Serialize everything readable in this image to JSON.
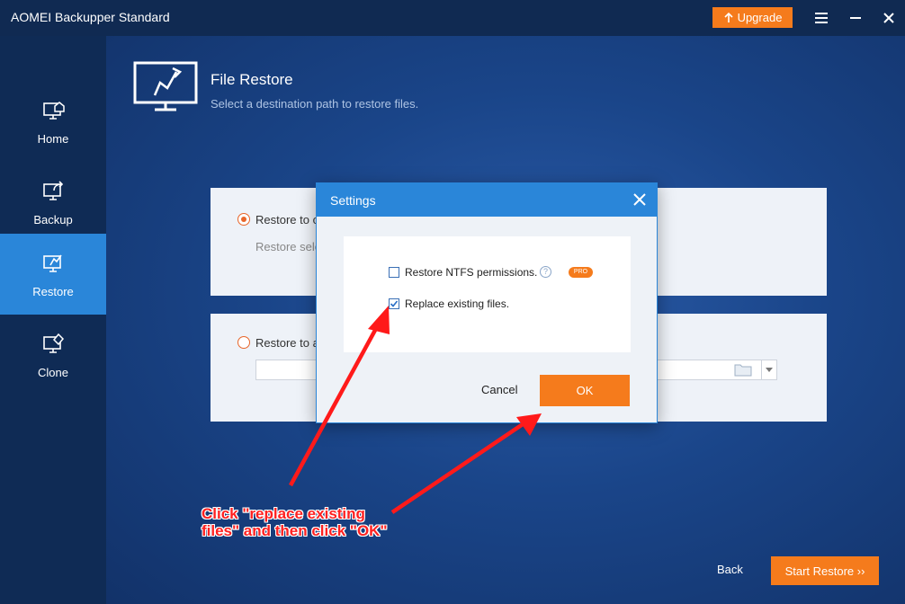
{
  "app": {
    "title": "AOMEI Backupper Standard"
  },
  "titlebar": {
    "upgrade_label": "Upgrade"
  },
  "sidebar": {
    "items": [
      {
        "label": "Home",
        "icon": "home-icon",
        "active": false
      },
      {
        "label": "Backup",
        "icon": "backup-icon",
        "active": false
      },
      {
        "label": "Restore",
        "icon": "restore-icon",
        "active": true
      },
      {
        "label": "Clone",
        "icon": "clone-icon",
        "active": false
      }
    ]
  },
  "header": {
    "title": "File Restore",
    "subtitle": "Select a destination path to restore files."
  },
  "options": {
    "original": {
      "label": "Restore to o",
      "sub": "Restore sele",
      "selected": true
    },
    "new_location": {
      "label": "Restore to a",
      "path_value": "",
      "selected": false
    }
  },
  "footer": {
    "back_label": "Back",
    "start_label": "Start Restore ››"
  },
  "dialog": {
    "title": "Settings",
    "ntfs_label": "Restore NTFS permissions.",
    "ntfs_checked": false,
    "help_glyph": "?",
    "pro_badge": "PRO",
    "replace_label": "Replace existing files.",
    "replace_checked": true,
    "cancel_label": "Cancel",
    "ok_label": "OK"
  },
  "annotation": {
    "line1": "Click \"replace existing",
    "line2": "files\" and then click \"OK\""
  },
  "colors": {
    "accent_orange": "#f57b1c",
    "active_blue": "#2a86d9",
    "annotation_red": "#ff2020"
  }
}
